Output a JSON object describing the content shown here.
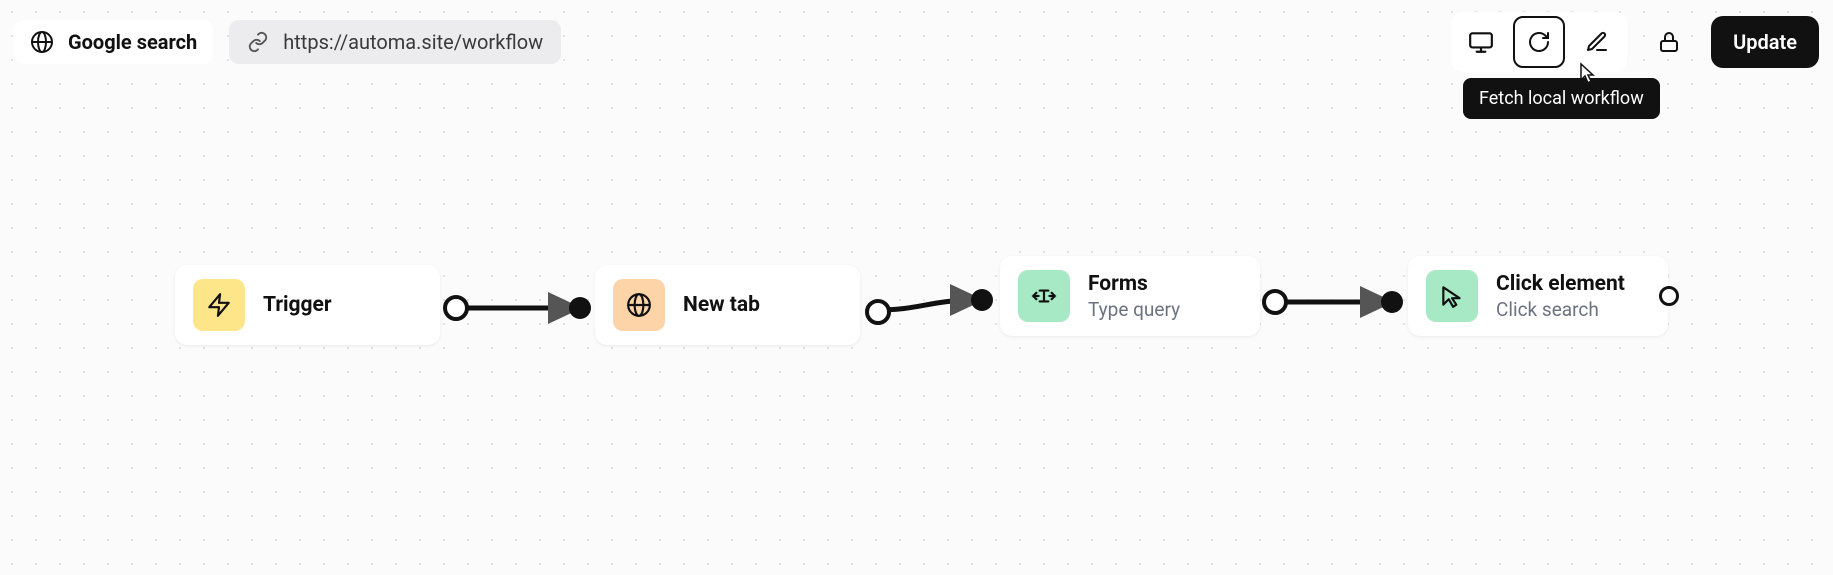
{
  "header": {
    "title": "Google search",
    "url": "https://automa.site/workflow",
    "update_label": "Update",
    "tooltip": "Fetch local workflow"
  },
  "nodes": {
    "trigger": {
      "title": "Trigger"
    },
    "newtab": {
      "title": "New tab"
    },
    "forms": {
      "title": "Forms",
      "sub": "Type query"
    },
    "click": {
      "title": "Click element",
      "sub": "Click search"
    }
  }
}
